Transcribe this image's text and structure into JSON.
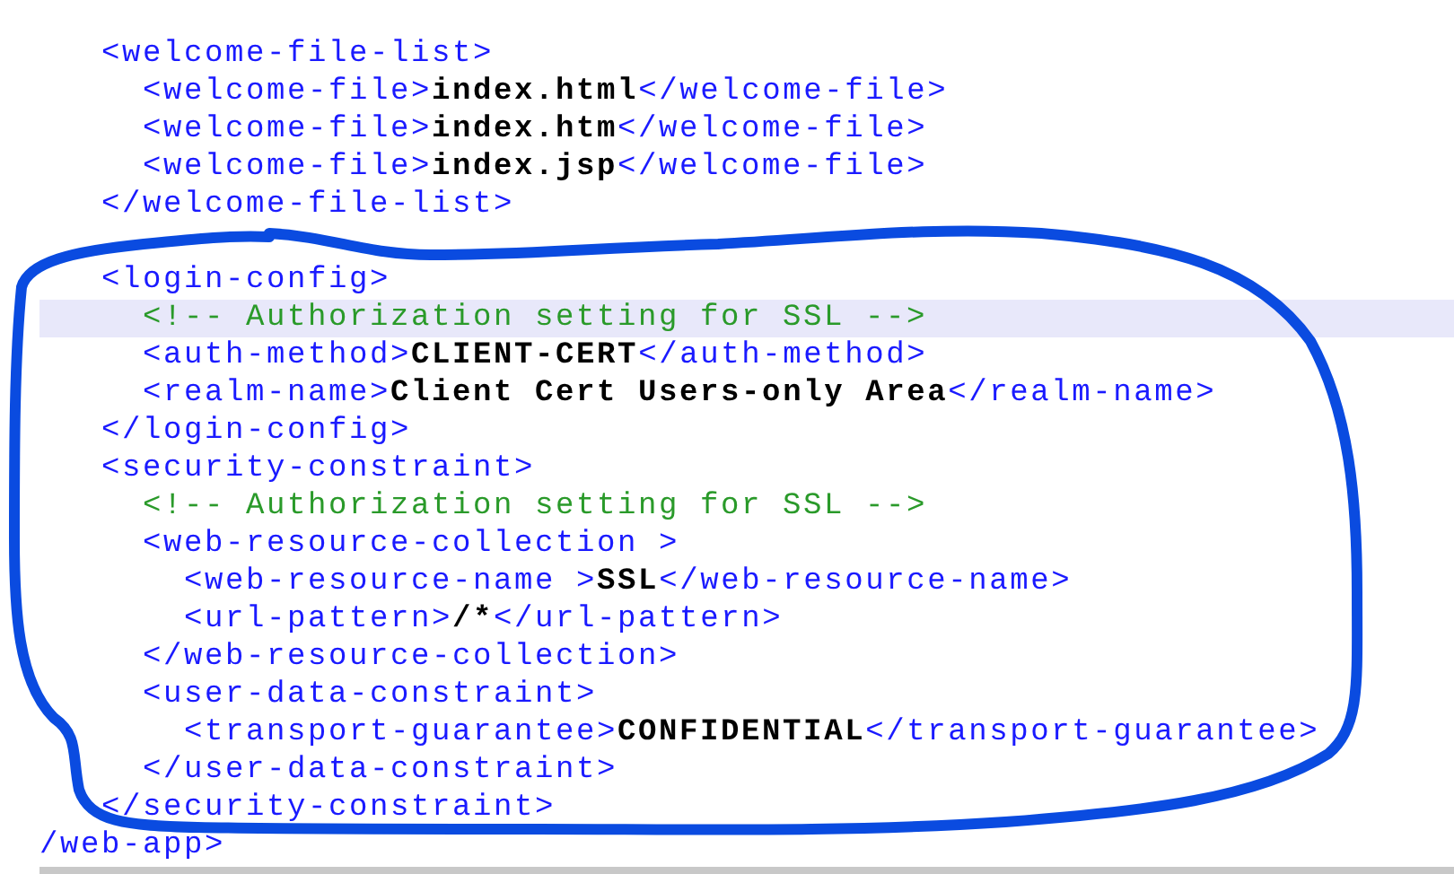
{
  "editor": {
    "lines": [
      {
        "kind": "element",
        "tokens": [
          {
            "kind": "tag",
            "text": "<welcome-file-list>"
          }
        ],
        "children": [
          {
            "kind": "element",
            "tokens": [
              {
                "kind": "tag",
                "text": "<welcome-file>"
              },
              {
                "kind": "value",
                "text": "index.html"
              },
              {
                "kind": "tag",
                "text": "</welcome-file>"
              }
            ]
          },
          {
            "kind": "element",
            "tokens": [
              {
                "kind": "tag",
                "text": "<welcome-file>"
              },
              {
                "kind": "value",
                "text": "index.htm"
              },
              {
                "kind": "tag",
                "text": "</welcome-file>"
              }
            ]
          },
          {
            "kind": "element",
            "tokens": [
              {
                "kind": "tag",
                "text": "<welcome-file>"
              },
              {
                "kind": "value",
                "text": "index.jsp"
              },
              {
                "kind": "tag",
                "text": "</welcome-file>"
              }
            ]
          }
        ]
      },
      {
        "kind": "element",
        "tokens": [
          {
            "kind": "tag",
            "text": "</welcome-file-list>"
          }
        ]
      },
      {
        "kind": "blank"
      },
      {
        "kind": "element",
        "tokens": [
          {
            "kind": "tag",
            "text": "<login-config>"
          }
        ],
        "children": [
          {
            "kind": "element",
            "highlighted": true,
            "tokens": [
              {
                "kind": "comment",
                "text": "<!-- Authorization setting for SSL -->"
              }
            ]
          },
          {
            "kind": "element",
            "tokens": [
              {
                "kind": "tag",
                "text": "<auth-method>"
              },
              {
                "kind": "value",
                "text": "CLIENT-CERT"
              },
              {
                "kind": "tag",
                "text": "</auth-method>"
              }
            ]
          },
          {
            "kind": "element",
            "tokens": [
              {
                "kind": "tag",
                "text": "<realm-name>"
              },
              {
                "kind": "value",
                "text": "Client Cert Users-only Area"
              },
              {
                "kind": "tag",
                "text": "</realm-name>"
              }
            ]
          }
        ]
      },
      {
        "kind": "element",
        "tokens": [
          {
            "kind": "tag",
            "text": "</login-config>"
          }
        ]
      },
      {
        "kind": "element",
        "tokens": [
          {
            "kind": "tag",
            "text": "<security-constraint>"
          }
        ],
        "children": [
          {
            "kind": "element",
            "tokens": [
              {
                "kind": "comment",
                "text": "<!-- Authorization setting for SSL -->"
              }
            ]
          },
          {
            "kind": "element",
            "tokens": [
              {
                "kind": "tag",
                "text": "<web-resource-collection >"
              }
            ],
            "children": [
              {
                "kind": "element",
                "tokens": [
                  {
                    "kind": "tag",
                    "text": "<web-resource-name >"
                  },
                  {
                    "kind": "value",
                    "text": "SSL"
                  },
                  {
                    "kind": "tag",
                    "text": "</web-resource-name>"
                  }
                ]
              },
              {
                "kind": "element",
                "tokens": [
                  {
                    "kind": "tag",
                    "text": "<url-pattern>"
                  },
                  {
                    "kind": "value",
                    "text": "/*"
                  },
                  {
                    "kind": "tag",
                    "text": "</url-pattern>"
                  }
                ]
              }
            ]
          },
          {
            "kind": "element",
            "tokens": [
              {
                "kind": "tag",
                "text": "</web-resource-collection>"
              }
            ]
          },
          {
            "kind": "element",
            "tokens": [
              {
                "kind": "tag",
                "text": "<user-data-constraint>"
              }
            ],
            "children": [
              {
                "kind": "element",
                "tokens": [
                  {
                    "kind": "tag",
                    "text": "<transport-guarantee>"
                  },
                  {
                    "kind": "value",
                    "text": "CONFIDENTIAL"
                  },
                  {
                    "kind": "tag",
                    "text": "</transport-guarantee>"
                  }
                ]
              }
            ]
          },
          {
            "kind": "element",
            "tokens": [
              {
                "kind": "tag",
                "text": "</user-data-constraint>"
              }
            ]
          }
        ]
      },
      {
        "kind": "element",
        "tokens": [
          {
            "kind": "tag",
            "text": "</security-constraint>"
          }
        ]
      },
      {
        "kind": "root",
        "tokens": [
          {
            "kind": "tag",
            "text": "/web-app>"
          }
        ]
      }
    ]
  }
}
